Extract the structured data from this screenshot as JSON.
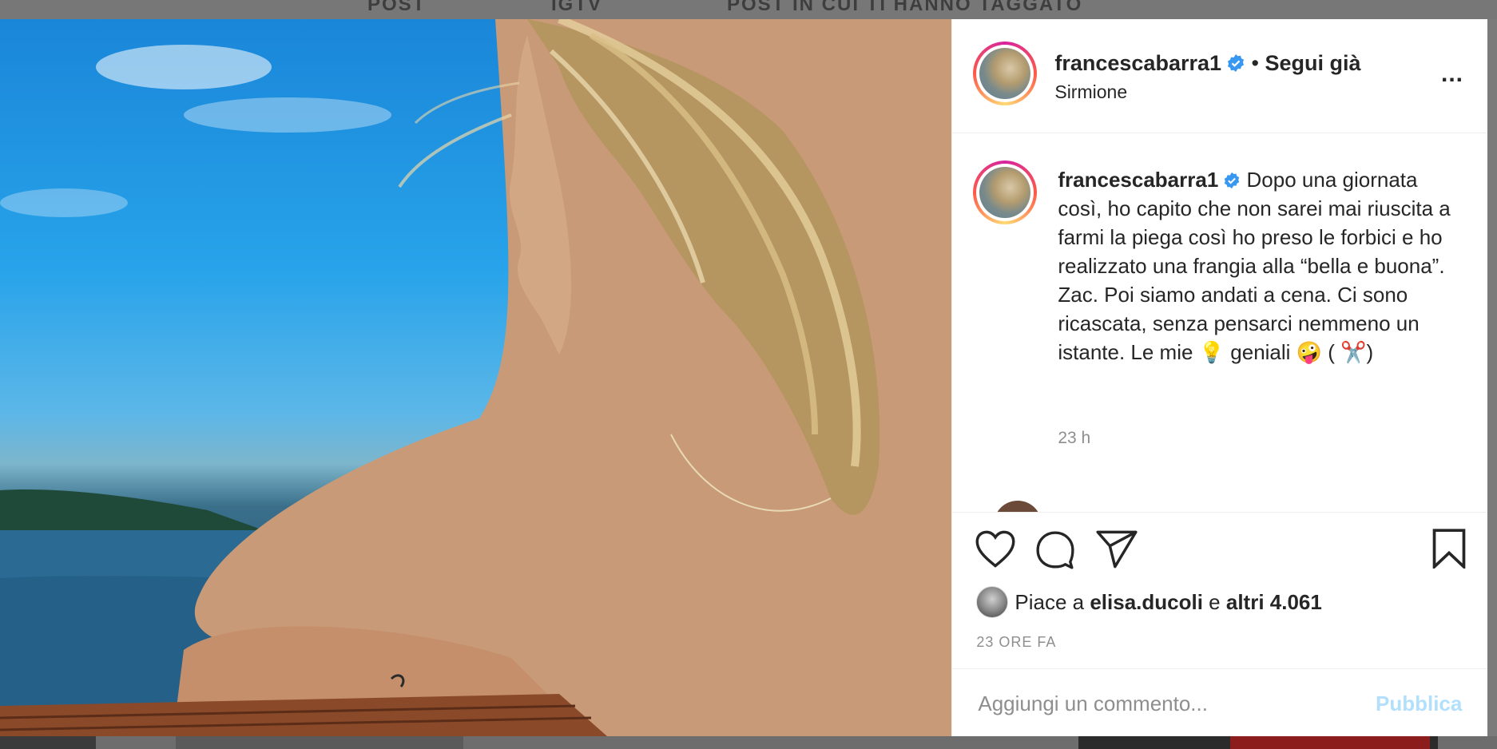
{
  "background": {
    "top_ghost_labels": [
      "POST",
      "IGTV",
      "POST IN CUI TI HANNO TAGGATO"
    ]
  },
  "post": {
    "photo_alt": "Foto",
    "header": {
      "username": "francescabarra1",
      "separator": "•",
      "follow_label": "Segui già",
      "location": "Sirmione",
      "more_label": "..."
    },
    "caption": {
      "username": "francescabarra1",
      "text": "Dopo una giornata così, ho capito che non sarei mai riuscita a farmi la piega così ho preso le forbici e ho realizzato una frangia alla “bella e buona”. Zac. Poi siamo andati a cena. Ci sono ricascata, senza pensarci nemmeno un istante. Le mie 💡 geniali 🤪 ( ✂️)",
      "time": "23 h"
    },
    "actions": {
      "like_icon": "heart-icon",
      "comment_icon": "comment-icon",
      "share_icon": "share-icon",
      "save_icon": "bookmark-icon"
    },
    "likes": {
      "prefix": "Piace a",
      "user": "elisa.ducoli",
      "conj": "e",
      "others": "altri 4.061"
    },
    "timestamp": "23 ORE FA",
    "comment": {
      "placeholder": "Aggiungi un commento...",
      "publish_label": "Pubblica"
    },
    "colors": {
      "verified": "#3897f0",
      "publish_disabled": "#b2dffc",
      "text": "#262626",
      "muted": "#8e8e8e"
    }
  }
}
